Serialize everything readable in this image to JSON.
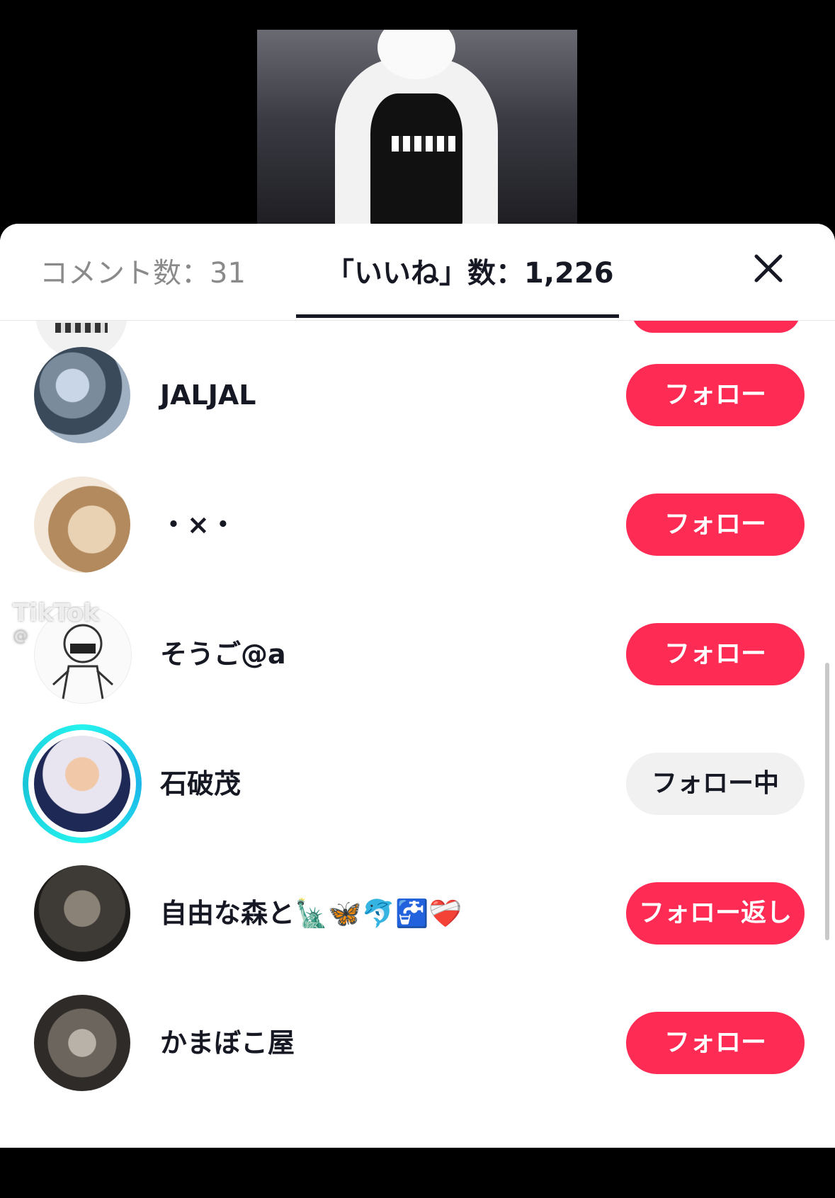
{
  "tabs": {
    "comments_label": "コメント数：31",
    "likes_label": "「いいね」数：1,226"
  },
  "users": [
    {
      "name": "JALJAL",
      "button": "フォロー",
      "state": "follow"
    },
    {
      "name": "・×・",
      "button": "フォロー",
      "state": "follow"
    },
    {
      "name": "そうご@a",
      "button": "フォロー",
      "state": "follow"
    },
    {
      "name": "石破茂",
      "button": "フォロー中",
      "state": "following"
    },
    {
      "name": "自由な森と🗽🦋🐬🚰❤️‍🩹",
      "button": "フォロー返し",
      "state": "follow-back"
    },
    {
      "name": "かまぼこ屋",
      "button": "フォロー",
      "state": "follow"
    }
  ],
  "watermark": {
    "brand": "TikTok",
    "handle": "@"
  },
  "colors": {
    "accent": "#fe2c55",
    "text": "#161823",
    "muted": "#8a8a8a",
    "ring": "#25f4ee"
  },
  "icons": [
    "close-icon",
    "tiktok-logo-icon"
  ]
}
